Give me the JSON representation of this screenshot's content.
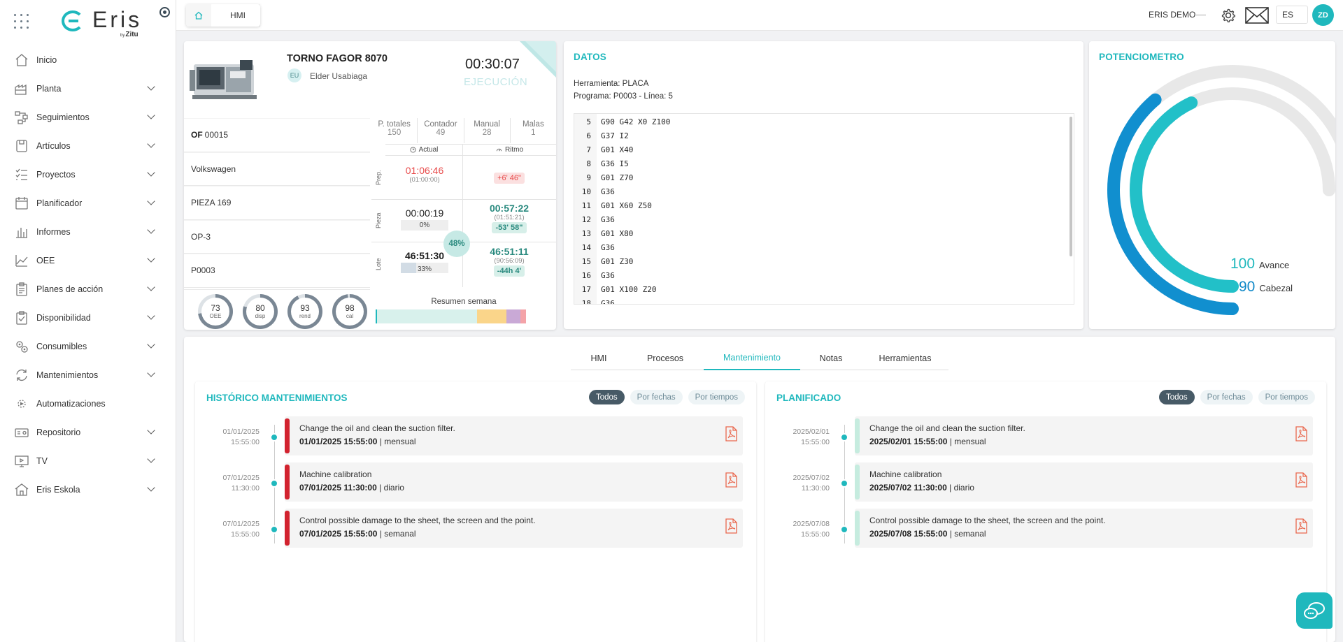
{
  "app": {
    "brand": "Eris",
    "brand_by": "Zitu",
    "brand_by_prefix": "by"
  },
  "sidebar": {
    "items": [
      {
        "label": "Inicio",
        "icon": "home-icon",
        "expandable": false
      },
      {
        "label": "Planta",
        "icon": "factory-icon",
        "expandable": true
      },
      {
        "label": "Seguimientos",
        "icon": "flow-icon",
        "expandable": true
      },
      {
        "label": "Artículos",
        "icon": "box-icon",
        "expandable": true
      },
      {
        "label": "Proyectos",
        "icon": "checklist-icon",
        "expandable": true
      },
      {
        "label": "Planificador",
        "icon": "calendar-icon",
        "expandable": true
      },
      {
        "label": "Informes",
        "icon": "bar-chart-icon",
        "expandable": true
      },
      {
        "label": "OEE",
        "icon": "line-chart-icon",
        "expandable": true
      },
      {
        "label": "Planes de acción",
        "icon": "clipboard-icon",
        "expandable": true
      },
      {
        "label": "Disponibilidad",
        "icon": "clipboard-check-icon",
        "expandable": true
      },
      {
        "label": "Consumibles",
        "icon": "gears-icon",
        "expandable": true
      },
      {
        "label": "Mantenimientos",
        "icon": "refresh-icon",
        "expandable": true
      },
      {
        "label": "Automatizaciones",
        "icon": "automation-icon",
        "expandable": false
      },
      {
        "label": "Repositorio",
        "icon": "database-icon",
        "expandable": true
      },
      {
        "label": "TV",
        "icon": "tv-icon",
        "expandable": true
      },
      {
        "label": "Eris Eskola",
        "icon": "school-icon",
        "expandable": true
      }
    ]
  },
  "topbar": {
    "breadcrumb": [
      "HMI"
    ],
    "user": "ERIS DEMO",
    "lang": "ES",
    "avatar_initials": "ZD"
  },
  "machine": {
    "name": "TORNO FAGOR 8070",
    "operator_initials": "EU",
    "operator": "Elder Usabiaga",
    "timer": "00:30:07",
    "state": "EJECUCIÓN",
    "of_label": "OF",
    "of_value": "00015",
    "customer": "Volkswagen",
    "piece": "PIEZA 169",
    "operation": "OP-3",
    "program": "P0003",
    "counts": [
      {
        "label": "P. totales",
        "value": "150"
      },
      {
        "label": "Contador",
        "value": "49"
      },
      {
        "label": "Manual",
        "value": "28"
      },
      {
        "label": "Malas",
        "value": "1"
      }
    ],
    "times": {
      "header_actual": "Actual",
      "header_ritmo": "Ritmo",
      "prep_label": "Prep.",
      "pieza_label": "Pieza",
      "lote_label": "Lote",
      "prep_actual": "01:06:46",
      "prep_actual_sub": "(01:00:00)",
      "prep_ritmo": "+6' 46\"",
      "pieza_actual": "00:00:19",
      "pieza_pct": "0%",
      "pieza_ritmo": "00:57:22",
      "pieza_ritmo_sub": "(01:51:21)",
      "pieza_diff": "-53' 58\"",
      "lote_actual": "46:51:30",
      "lote_pct": "33%",
      "lote_ritmo": "46:51:11",
      "lote_ritmo_sub": "(90:56:09)",
      "lote_diff": "-44h 4'",
      "center_pct": "48%"
    },
    "kpis": [
      {
        "value": "73",
        "label": "OEE",
        "fraction": 0.73
      },
      {
        "value": "80",
        "label": "disp",
        "fraction": 0.8
      },
      {
        "value": "93",
        "label": "rend",
        "fraction": 0.93
      },
      {
        "value": "98",
        "label": "cal",
        "fraction": 0.98
      }
    ],
    "week_summary_label": "Resumen semana",
    "week_summary": [
      {
        "fraction": 0.57,
        "color": "#d8f1ec"
      },
      {
        "fraction": 0.17,
        "color": "#fad58a"
      },
      {
        "fraction": 0.08,
        "color": "#c9a9d6"
      },
      {
        "fraction": 0.03,
        "color": "#f4a3a8"
      }
    ]
  },
  "datos": {
    "title": "DATOS",
    "tool": "Herramienta: PLACA",
    "program": "Programa: P0003 - Línea: 5",
    "code": [
      {
        "n": "5",
        "c": "G90 G42 X0 Z100"
      },
      {
        "n": "6",
        "c": "G37 I2"
      },
      {
        "n": "7",
        "c": "G01 X40"
      },
      {
        "n": "8",
        "c": "G36 I5"
      },
      {
        "n": "9",
        "c": "G01 Z70"
      },
      {
        "n": "10",
        "c": "G36"
      },
      {
        "n": "11",
        "c": "G01 X60 Z50"
      },
      {
        "n": "12",
        "c": "G36"
      },
      {
        "n": "13",
        "c": "G01 X80"
      },
      {
        "n": "14",
        "c": "G36"
      },
      {
        "n": "15",
        "c": "G01 Z30"
      },
      {
        "n": "16",
        "c": "G36"
      },
      {
        "n": "17",
        "c": "G01 X100 Z20"
      },
      {
        "n": "18",
        "c": "G36"
      }
    ]
  },
  "potenciometro": {
    "title": "POTENCIOMETRO",
    "avance_value": "100",
    "avance_label": "Avance",
    "cabezal_value": "90",
    "cabezal_label": "Cabezal",
    "avance_fraction": 1.0,
    "cabezal_fraction": 0.9,
    "colors": {
      "avance": "#22c0c8",
      "cabezal": "#118fcf",
      "track": "#e8e8e8"
    }
  },
  "tabs": [
    {
      "label": "HMI",
      "active": false
    },
    {
      "label": "Procesos",
      "active": false
    },
    {
      "label": "Mantenimiento",
      "active": true
    },
    {
      "label": "Notas",
      "active": false
    },
    {
      "label": "Herramientas",
      "active": false
    }
  ],
  "historico": {
    "title": "HISTÓRICO MANTENIMIENTOS",
    "filters": [
      "Todos",
      "Por fechas",
      "Por tiempos"
    ],
    "events": [
      {
        "date1": "01/01/2025",
        "date2": "15:55:00",
        "title": "Change the oil and clean the suction filter.",
        "when": "01/01/2025 15:55:00",
        "freq": "mensual",
        "bar_color": "#d2232f"
      },
      {
        "date1": "07/01/2025",
        "date2": "11:30:00",
        "title": "Machine calibration",
        "when": "07/01/2025 11:30:00",
        "freq": "diario",
        "bar_color": "#d2232f"
      },
      {
        "date1": "07/01/2025",
        "date2": "15:55:00",
        "title": "Control possible damage to the sheet, the screen and the point.",
        "when": "07/01/2025 15:55:00",
        "freq": "semanal",
        "bar_color": "#d2232f"
      }
    ]
  },
  "planificado": {
    "title": "PLANIFICADO",
    "filters": [
      "Todos",
      "Por fechas",
      "Por tiempos"
    ],
    "events": [
      {
        "date1": "2025/02/01",
        "date2": "15:55:00",
        "title": "Change the oil and clean the suction filter.",
        "when": "2025/02/01 15:55:00",
        "freq": "mensual",
        "bar_color": "#c6ecdf"
      },
      {
        "date1": "2025/07/02",
        "date2": "11:30:00",
        "title": "Machine calibration",
        "when": "2025/07/02 11:30:00",
        "freq": "diario",
        "bar_color": "#c6ecdf"
      },
      {
        "date1": "2025/07/08",
        "date2": "15:55:00",
        "title": "Control possible damage to the sheet, the screen and the point.",
        "when": "2025/07/08 15:55:00",
        "freq": "semanal",
        "bar_color": "#c6ecdf"
      }
    ]
  },
  "colors": {
    "accent": "#1fb8bd",
    "danger": "#e84a4a",
    "success": "#2a8a7f"
  }
}
